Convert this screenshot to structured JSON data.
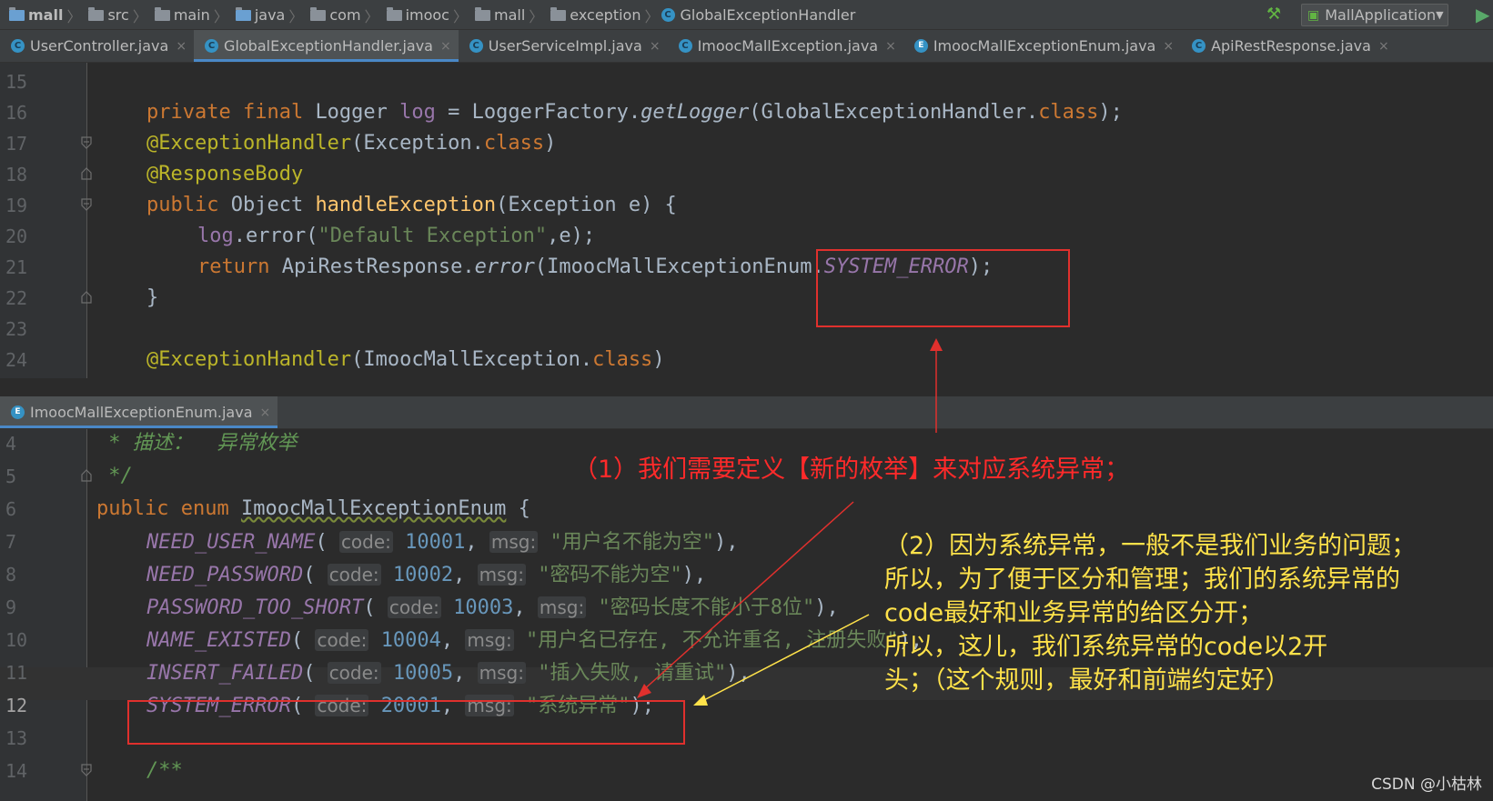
{
  "breadcrumb": [
    "mall",
    "src",
    "main",
    "java",
    "com",
    "imooc",
    "mall",
    "exception",
    "GlobalExceptionHandler"
  ],
  "run_config": "MallApplication",
  "tabs": [
    {
      "label": "UserController.java",
      "active": false
    },
    {
      "label": "GlobalExceptionHandler.java",
      "active": true
    },
    {
      "label": "UserServiceImpl.java",
      "active": false
    },
    {
      "label": "ImoocMallException.java",
      "active": false
    },
    {
      "label": "ImoocMallExceptionEnum.java",
      "active": false
    },
    {
      "label": "ApiRestResponse.java",
      "active": false
    }
  ],
  "close_glyph": "×",
  "top_editor": {
    "line_numbers": [
      "15",
      "16",
      "17",
      "18",
      "19",
      "20",
      "21",
      "22",
      "23",
      "24"
    ],
    "l16": {
      "kw1": "private final ",
      "t1": "Logger ",
      "f1": "log",
      "t2": " = LoggerFactory.",
      "m1": "getLogger",
      "t3": "(GlobalExceptionHandler.",
      "kw2": "class",
      "t4": ");"
    },
    "l17": {
      "a1": "@ExceptionHandler",
      "t1": "(Exception.",
      "kw1": "class",
      "t2": ")"
    },
    "l18": {
      "a1": "@ResponseBody"
    },
    "l19": {
      "kw1": "public ",
      "t1": "Object ",
      "fn1": "handleException",
      "t2": "(Exception e) {"
    },
    "l20": {
      "f1": "log",
      "t1": ".error(",
      "s1": "\"Default Exception\"",
      "t2": ",e);"
    },
    "l21": {
      "kw1": "return ",
      "t1": "ApiRestResponse.",
      "m1": "error",
      "t2": "(ImoocMallExceptionEnum.",
      "c1": "SYSTEM_ERROR",
      "t3": ");"
    },
    "l22": {
      "t1": "}"
    },
    "l24": {
      "a1": "@ExceptionHandler",
      "t1": "(ImoocMallException.",
      "kw1": "class",
      "t2": ")"
    }
  },
  "bottom_tab": {
    "label": "ImoocMallExceptionEnum.java"
  },
  "bottom_editor": {
    "line_numbers": [
      "4",
      "5",
      "6",
      "7",
      "8",
      "9",
      "10",
      "11",
      "12",
      "13",
      "14"
    ],
    "l4": {
      "c1": " * 描述：  异常枚举"
    },
    "l5": {
      "c1": " */"
    },
    "l6": {
      "kw1": "public enum ",
      "n1": "ImoocMallExceptionEnum",
      " t1": " {",
      "t1": " {"
    },
    "enum_lines": [
      {
        "name": "NEED_USER_NAME",
        "code": "10001",
        "msg": "\"用户名不能为空\"",
        "end": "),"
      },
      {
        "name": "NEED_PASSWORD",
        "code": "10002",
        "msg": "\"密码不能为空\"",
        "end": "),"
      },
      {
        "name": "PASSWORD_TOO_SHORT",
        "code": "10003",
        "msg": "\"密码长度不能小于8位\"",
        "end": "),"
      },
      {
        "name": "NAME_EXISTED",
        "code": "10004",
        "msg": "\"用户名已存在, 不允许重名, 注册失败\"",
        "end": "),"
      },
      {
        "name": "INSERT_FAILED",
        "code": "10005",
        "msg": "\"插入失败, 请重试\"",
        "end": "),"
      },
      {
        "name": "SYSTEM_ERROR",
        "code": "20001",
        "msg": "\"系统异常\"",
        "end": ");"
      }
    ],
    "hint_code": "code:",
    "hint_msg": "msg:",
    "l14": {
      "c1": "/**"
    }
  },
  "annotations": {
    "note1": "（1）我们需要定义【新的枚举】来对应系统异常；",
    "note2_lines": [
      "（2）因为系统异常，一般不是我们业务的问题；",
      "所以，为了便于区分和管理；我们的系统异常的",
      "code最好和业务异常的给区分开；",
      "所以，这儿，我们系统异常的code以2开",
      "头；（这个规则，最好和前端约定好）"
    ]
  },
  "watermark": "CSDN @小枯林",
  "colors": {
    "red": "#e0302d",
    "yellow": "#ffe24a",
    "keyword": "#cc7832",
    "annotation": "#bbb529",
    "string": "#6a8759",
    "number": "#6897bb",
    "constant": "#9876aa"
  }
}
